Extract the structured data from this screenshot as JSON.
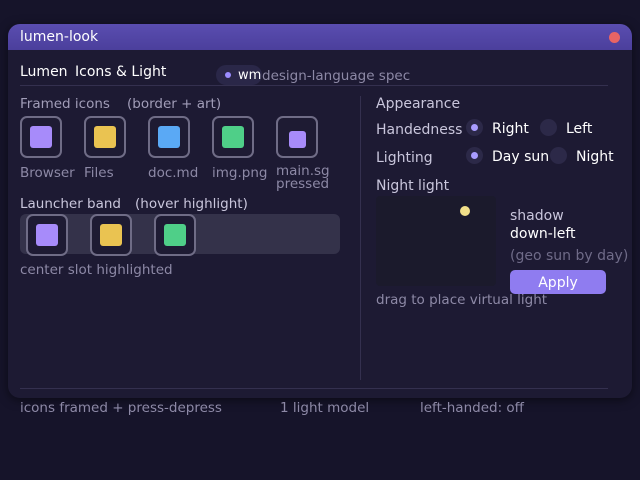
{
  "window": {
    "title": "lumen-look"
  },
  "header": {
    "brand": "Lumen",
    "subtitle": "Icons & Light",
    "tag_label": "wm",
    "tag_caption": "design-language spec"
  },
  "framed_icons": {
    "heading": "Framed icons",
    "hint": "(border + art)",
    "items": [
      {
        "label": "Browser",
        "color": "#a78bfa"
      },
      {
        "label": "Files",
        "color": "#eac351"
      },
      {
        "label": "doc.md",
        "color": "#5aa9f5"
      },
      {
        "label": "img.png",
        "color": "#4fcf88"
      },
      {
        "label": "main.sg",
        "sublabel": "pressed",
        "color": "#a78bfa"
      }
    ]
  },
  "launcher": {
    "heading": "Launcher band",
    "hint": "(hover highlight)",
    "caption": "center slot highlighted",
    "slot_colors": [
      "#a78bfa",
      "#eac351",
      "#4fcf88"
    ]
  },
  "appearance": {
    "heading": "Appearance",
    "handedness": {
      "label": "Handedness",
      "options": [
        "Right",
        "Left"
      ],
      "selected": "Right"
    },
    "lighting": {
      "label": "Lighting",
      "options": [
        "Day sun",
        "Night"
      ],
      "selected": "Day sun"
    }
  },
  "night_light": {
    "heading": "Night light",
    "shadow_label": "shadow",
    "shadow_value": "down-left",
    "note": "(geo sun by day)",
    "apply_label": "Apply",
    "caption": "drag to place virtual light"
  },
  "status_bar": {
    "left": "icons framed + press-depress",
    "middle": "1 light model",
    "right": "left-handed: off"
  },
  "colors": {
    "accent": "#8f7cf0",
    "close": "#e86464",
    "sun": "#f2e08a"
  }
}
